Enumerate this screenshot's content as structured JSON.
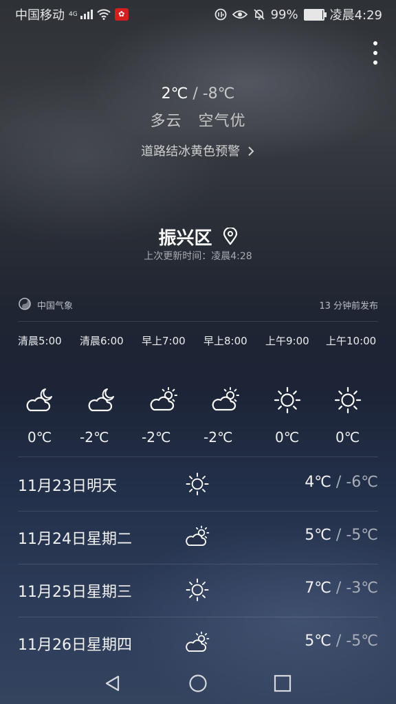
{
  "status_bar": {
    "carrier": "中国移动",
    "network": "4G",
    "battery": "99%",
    "time": "凌晨4:29"
  },
  "today": {
    "high": "2℃",
    "separator": "/",
    "low": "-8℃",
    "condition": "多云",
    "air_quality": "空气优",
    "warning": "道路结冰黄色预警"
  },
  "location": {
    "name": "振兴区",
    "update_time": "上次更新时间：凌晨4:28"
  },
  "source": {
    "name": "中国气象",
    "published": "13 分钟前发布"
  },
  "hourly": [
    {
      "time": "清晨5:00",
      "icon": "cloudy-night-icon",
      "temp": "0℃"
    },
    {
      "time": "清晨6:00",
      "icon": "cloudy-night-icon",
      "temp": "-2℃"
    },
    {
      "time": "早上7:00",
      "icon": "partly-cloudy-icon",
      "temp": "-2℃"
    },
    {
      "time": "早上8:00",
      "icon": "partly-cloudy-icon",
      "temp": "-2℃"
    },
    {
      "time": "上午9:00",
      "icon": "sunny-icon",
      "temp": "0℃"
    },
    {
      "time": "上午10:00",
      "icon": "sunny-icon",
      "temp": "0℃"
    }
  ],
  "daily": [
    {
      "date": "11月23日明天",
      "icon": "sunny-icon",
      "high": "4℃",
      "low": "-6℃"
    },
    {
      "date": "11月24日星期二",
      "icon": "partly-cloudy-icon",
      "high": "5℃",
      "low": "-5℃"
    },
    {
      "date": "11月25日星期三",
      "icon": "sunny-icon",
      "high": "7℃",
      "low": "-3℃"
    },
    {
      "date": "11月26日星期四",
      "icon": "partly-cloudy-icon",
      "high": "5℃",
      "low": "-5℃"
    }
  ]
}
